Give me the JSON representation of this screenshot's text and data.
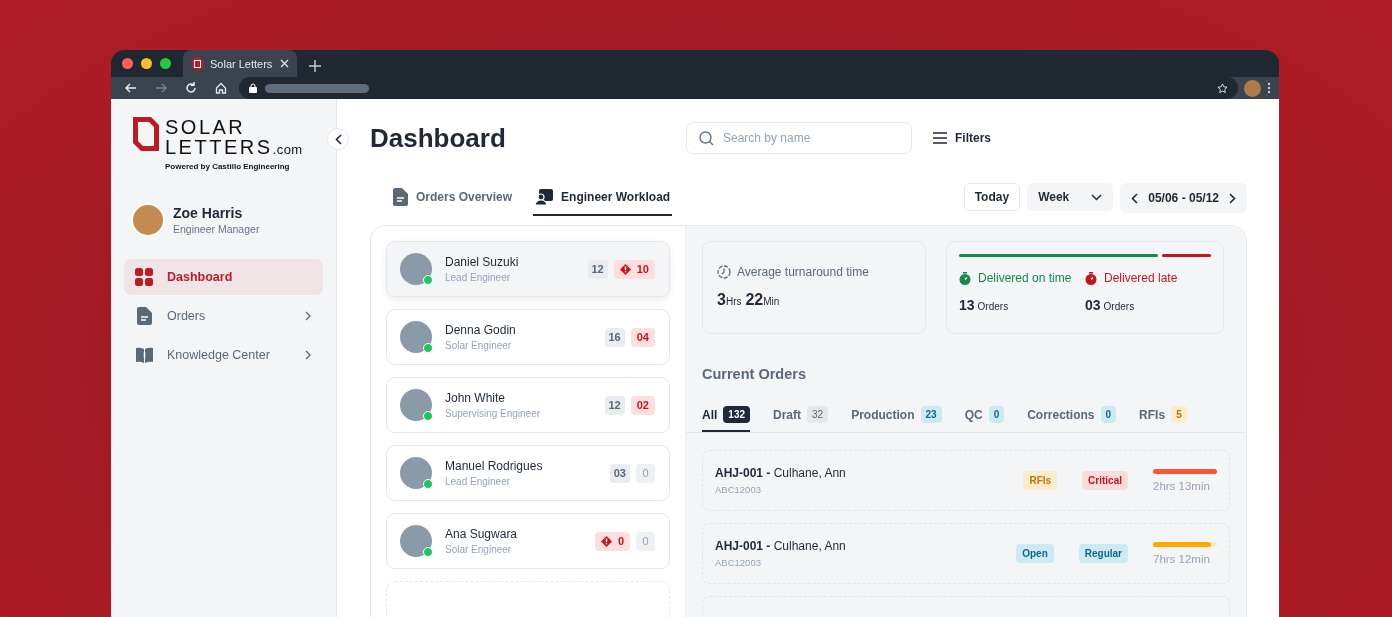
{
  "browser": {
    "tab_title": "Solar Letters"
  },
  "sidebar": {
    "logo": {
      "line1": "SOLAR",
      "line2": "LETTERS",
      "suffix": ".com",
      "tagline": "Powered by Castillo Engineering"
    },
    "user": {
      "name": "Zoe Harris",
      "role": "Engineer Manager"
    },
    "items": [
      {
        "label": "Dashboard",
        "selected": true,
        "expandable": false
      },
      {
        "label": "Orders",
        "selected": false,
        "expandable": true
      },
      {
        "label": "Knowledge Center",
        "selected": false,
        "expandable": true
      }
    ]
  },
  "header": {
    "title": "Dashboard",
    "search": {
      "placeholder": "Search by name"
    },
    "filters": "Filters"
  },
  "tabs": [
    {
      "label": "Orders Overview",
      "selected": false
    },
    {
      "label": "Engineer Workload",
      "selected": true
    }
  ],
  "date_controls": {
    "today": "Today",
    "period": "Week",
    "range": "05/06 - 05/12"
  },
  "engineers": [
    {
      "name": "Daniel Suzuki",
      "role": "Lead Engineer",
      "online": true,
      "selected": true,
      "badges": [
        {
          "text": "12",
          "kind": "neutral",
          "alert": false
        },
        {
          "text": "10",
          "kind": "danger",
          "alert": true
        }
      ]
    },
    {
      "name": "Denna Godin",
      "role": "Solar Engineer",
      "online": true,
      "selected": false,
      "badges": [
        {
          "text": "16",
          "kind": "neutral",
          "alert": false
        },
        {
          "text": "04",
          "kind": "danger",
          "alert": false
        }
      ]
    },
    {
      "name": "John White",
      "role": "Supervising Engineer",
      "online": true,
      "selected": false,
      "badges": [
        {
          "text": "12",
          "kind": "neutral",
          "alert": false
        },
        {
          "text": "02",
          "kind": "danger",
          "alert": false
        }
      ]
    },
    {
      "name": "Manuel Rodrigues",
      "role": "Lead Engineer",
      "online": true,
      "selected": false,
      "badges": [
        {
          "text": "03",
          "kind": "neutral",
          "alert": false
        },
        {
          "text": "0",
          "kind": "muted",
          "alert": false
        }
      ]
    },
    {
      "name": "Ana Sugwara",
      "role": "Solar Engineer",
      "online": true,
      "selected": false,
      "badges": [
        {
          "text": "0",
          "kind": "danger",
          "alert": true
        },
        {
          "text": "0",
          "kind": "muted",
          "alert": false
        }
      ]
    }
  ],
  "turnaround": {
    "label": "Average turnaround time",
    "parts": [
      {
        "value": "3",
        "unit": "Hrs"
      },
      {
        "value": "22",
        "unit": "Min"
      }
    ]
  },
  "delivery": {
    "level": 0.79,
    "on_time": {
      "label": "Delivered on time",
      "count": "13",
      "unit": "Orders"
    },
    "late": {
      "label": "Delivered late",
      "count": "03",
      "unit": "Orders"
    }
  },
  "current_orders": {
    "title": "Current Orders",
    "tabs": [
      {
        "label": "All",
        "count": "132",
        "kind": "dark",
        "selected": true
      },
      {
        "label": "Draft",
        "count": "32",
        "kind": "neutral",
        "selected": false
      },
      {
        "label": "Production",
        "count": "23",
        "kind": "info",
        "selected": false
      },
      {
        "label": "QC",
        "count": "0",
        "kind": "info",
        "selected": false
      },
      {
        "label": "Corrections",
        "count": "0",
        "kind": "info",
        "selected": false
      },
      {
        "label": "RFIs",
        "count": "5",
        "kind": "warning",
        "selected": false
      }
    ],
    "orders": [
      {
        "title": "**AHJ-001 -** Culhane, Ann",
        "code": "ABC12003",
        "tags": [
          {
            "text": "RFIs",
            "kind": "warning"
          },
          {
            "text": "Critical",
            "kind": "danger"
          }
        ],
        "level": 1.0,
        "color": "#ff5533",
        "time": "2hrs 13min"
      },
      {
        "title": "**AHJ-001 -** Culhane, Ann",
        "code": "ABC12003",
        "tags": [
          {
            "text": "Open",
            "kind": "info"
          },
          {
            "text": "Regular",
            "kind": "info"
          }
        ],
        "level": 0.9,
        "color": "#ffa800",
        "time": "7hrs 12min"
      }
    ]
  }
}
